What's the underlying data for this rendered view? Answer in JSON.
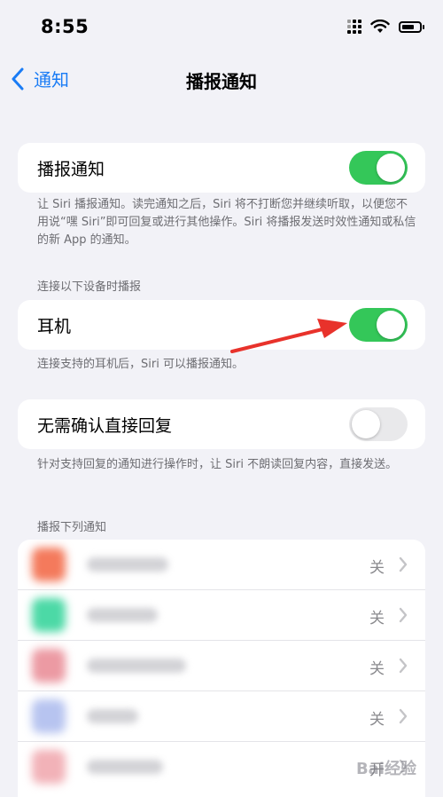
{
  "status_bar": {
    "time": "8:55"
  },
  "nav": {
    "back_label": "通知",
    "title": "播报通知"
  },
  "announce": {
    "label": "播报通知",
    "enabled": true,
    "footnote": "让 Siri 播报通知。读完通知之后，Siri 将不打断您并继续听取，以便您不用说“嘿 Siri”即可回复或进行其他操作。Siri 将播报发送时效性通知或私信的新 App 的通知。"
  },
  "devices_section": {
    "header": "连接以下设备时播报",
    "headphones_label": "耳机",
    "headphones_enabled": true,
    "footnote": "连接支持的耳机后，Siri 可以播报通知。"
  },
  "reply": {
    "label": "无需确认直接回复",
    "enabled": false,
    "footnote": "针对支持回复的通知进行操作时，让 Siri 不朗读回复内容，直接发送。"
  },
  "apps_section": {
    "header": "播报下列通知",
    "apps": [
      {
        "value": "关",
        "icon_color": "#f47a5c"
      },
      {
        "value": "关",
        "icon_color": "#4cd9a6"
      },
      {
        "value": "关",
        "icon_color": "#ec9aa3"
      },
      {
        "value": "关",
        "icon_color": "#b7c4f0"
      },
      {
        "value": "开",
        "icon_color": "#f2b2b8"
      }
    ]
  },
  "colors": {
    "accent": "#1a7cf5",
    "toggle_on": "#34c759",
    "annotation_arrow": "#e8322b"
  },
  "watermark": "Bai经验"
}
